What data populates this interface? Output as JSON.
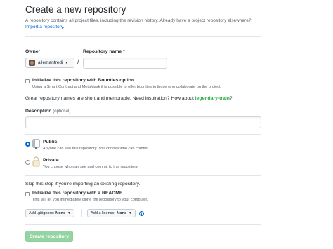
{
  "header": {
    "title": "Create a new repository",
    "intro_text": "A repository contains all project files, including the revision history. Already have a project repository elsewhere?",
    "import_link": "Import a repository."
  },
  "owner": {
    "label": "Owner",
    "value": "allemanfredi"
  },
  "repo_name": {
    "label": "Repository name",
    "required_mark": "*",
    "value": ""
  },
  "slash": "/",
  "bounties": {
    "title": "Initialize this repository with Bounties option",
    "desc": "Using a Smart Contract and MetaMask it is possible to offer bounties to those who collaborate on the project."
  },
  "inspiration": {
    "text": "Great repository names are short and memorable. Need inspiration? How about",
    "suggestion": "legendary-train",
    "suffix": "?"
  },
  "description": {
    "label": "Description",
    "optional": "(optional)",
    "value": ""
  },
  "visibility": {
    "public": {
      "title": "Public",
      "desc": "Anyone can see this repository. You choose who can commit.",
      "selected": true
    },
    "private": {
      "title": "Private",
      "desc": "You choose who can see and commit to this repository.",
      "selected": false
    }
  },
  "skip_text": "Skip this step if you're importing an existing repository.",
  "readme": {
    "title": "Initialize this repository with a README",
    "desc": "This will let you immediately clone the repository to your computer."
  },
  "gitignore": {
    "label": "Add .gitignore:",
    "value": "None"
  },
  "license": {
    "label": "Add a license:",
    "value": "None"
  },
  "submit_label": "Create repository",
  "colors": {
    "link": "#0366d6",
    "suggestion": "#28a745",
    "submit_bg": "#94d3a2"
  }
}
